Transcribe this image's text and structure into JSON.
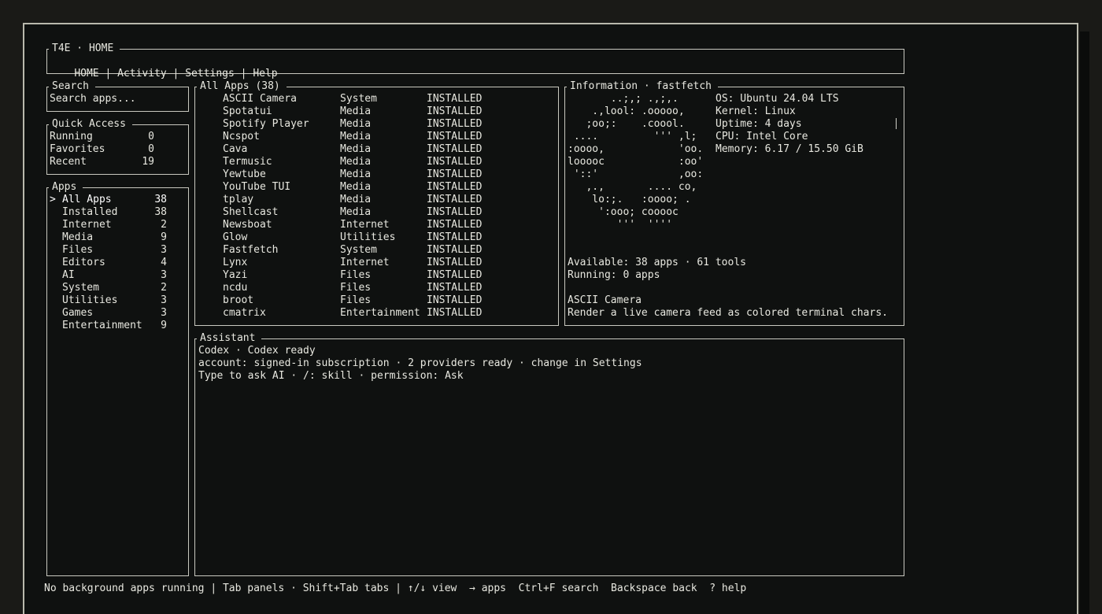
{
  "header": {
    "title": "T4E · HOME",
    "nav": [
      "HOME",
      "Activity",
      "Settings",
      "Help"
    ],
    "separator": " | "
  },
  "search": {
    "title": "Search",
    "placeholder": "Search apps..."
  },
  "quick_access": {
    "title": "Quick Access",
    "items": [
      {
        "label": "Running",
        "count": "0"
      },
      {
        "label": "Favorites",
        "count": "0"
      },
      {
        "label": "Recent",
        "count": "19"
      }
    ]
  },
  "apps_nav": {
    "title": "Apps",
    "selected_marker": ">",
    "items": [
      {
        "label": "All Apps",
        "count": "38"
      },
      {
        "label": "Installed",
        "count": "38"
      },
      {
        "label": "Internet",
        "count": "2"
      },
      {
        "label": "Media",
        "count": "9"
      },
      {
        "label": "Files",
        "count": "3"
      },
      {
        "label": "Editors",
        "count": "4"
      },
      {
        "label": "AI",
        "count": "3"
      },
      {
        "label": "System",
        "count": "2"
      },
      {
        "label": "Utilities",
        "count": "3"
      },
      {
        "label": "Games",
        "count": "3"
      },
      {
        "label": "Entertainment",
        "count": "9"
      }
    ]
  },
  "all_apps": {
    "title": "All Apps (38)",
    "rows": [
      {
        "name": "ASCII Camera",
        "category": "System",
        "status": "INSTALLED"
      },
      {
        "name": "Spotatui",
        "category": "Media",
        "status": "INSTALLED"
      },
      {
        "name": "Spotify Player",
        "category": "Media",
        "status": "INSTALLED"
      },
      {
        "name": "Ncspot",
        "category": "Media",
        "status": "INSTALLED"
      },
      {
        "name": "Cava",
        "category": "Media",
        "status": "INSTALLED"
      },
      {
        "name": "Termusic",
        "category": "Media",
        "status": "INSTALLED"
      },
      {
        "name": "Yewtube",
        "category": "Media",
        "status": "INSTALLED"
      },
      {
        "name": "YouTube TUI",
        "category": "Media",
        "status": "INSTALLED"
      },
      {
        "name": "tplay",
        "category": "Media",
        "status": "INSTALLED"
      },
      {
        "name": "Shellcast",
        "category": "Media",
        "status": "INSTALLED"
      },
      {
        "name": "Newsboat",
        "category": "Internet",
        "status": "INSTALLED"
      },
      {
        "name": "Glow",
        "category": "Utilities",
        "status": "INSTALLED"
      },
      {
        "name": "Fastfetch",
        "category": "System",
        "status": "INSTALLED"
      },
      {
        "name": "Lynx",
        "category": "Internet",
        "status": "INSTALLED"
      },
      {
        "name": "Yazi",
        "category": "Files",
        "status": "INSTALLED"
      },
      {
        "name": "ncdu",
        "category": "Files",
        "status": "INSTALLED"
      },
      {
        "name": "broot",
        "category": "Files",
        "status": "INSTALLED"
      },
      {
        "name": "cmatrix",
        "category": "Entertainment",
        "status": "INSTALLED"
      }
    ]
  },
  "information": {
    "title": "Information · fastfetch",
    "logo_lines": [
      "       ..;,; .,;,.",
      "    .,lool: .ooooo,",
      "   ;oo;:    .coool.",
      " ....         ''' ,l;",
      ":oooo,            'oo.",
      "looooc            :oo'",
      " '::'             ,oo:",
      "   ,.,       .... co,",
      "    lo:;.   :oooo; .",
      "     ':ooo; cooooc",
      "        '''  ''''"
    ],
    "sysinfo": [
      "OS: Ubuntu 24.04 LTS",
      "Kernel: Linux",
      "Uptime: 4 days",
      "CPU: Intel Core",
      "Memory: 6.17 / 15.50 GiB"
    ],
    "available": "Available: 38 apps · 61 tools",
    "running": "Running: 0 apps",
    "selected_app": "ASCII Camera",
    "selected_desc": "Render a live camera feed as colored terminal chars."
  },
  "assistant": {
    "title": "Assistant",
    "lines": [
      "Codex · Codex ready",
      "account: signed-in subscription · 2 providers ready · change in Settings",
      "Type to ask AI · /: skill · permission: Ask"
    ]
  },
  "statusbar": "No background apps running | Tab panels · Shift+Tab tabs | ↑/↓ view  → apps  Ctrl+F search  Backspace back  ? help",
  "colors": {
    "background": "#0f1110",
    "text": "#e8e8e0",
    "border": "#c9c9c0",
    "outer": "#1a1a17"
  }
}
